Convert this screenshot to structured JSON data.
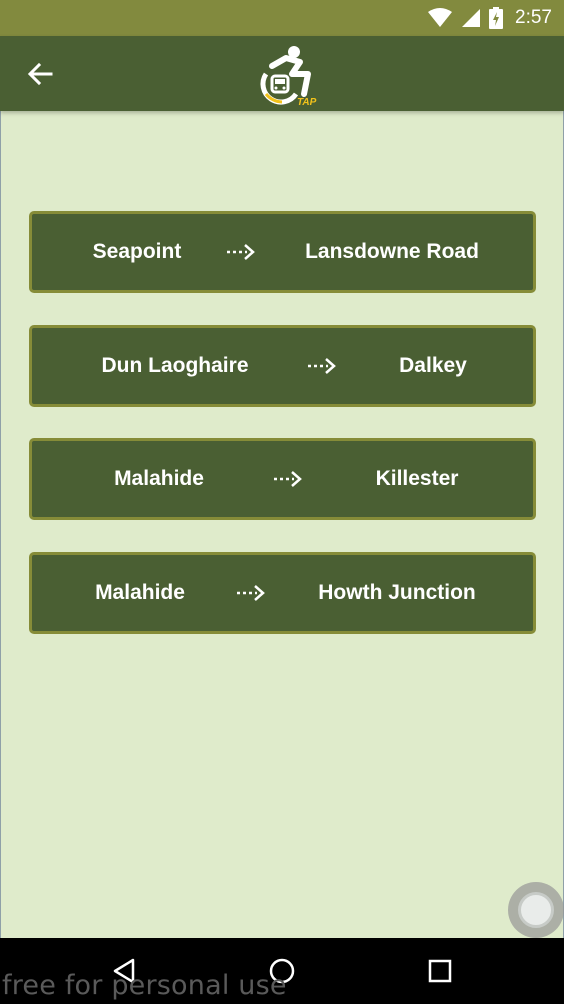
{
  "status_bar": {
    "time": "2:57",
    "icons": [
      "wifi-icon",
      "signal-icon",
      "battery-charging-icon"
    ]
  },
  "app_bar": {
    "back_icon": "arrow-left-icon",
    "logo_text": "TAP",
    "logo_icon": "accessible-train-icon"
  },
  "routes": [
    {
      "from": "Seapoint",
      "to": "Lansdowne Road"
    },
    {
      "from": "Dun Laoghaire",
      "to": "Dalkey"
    },
    {
      "from": "Malahide",
      "to": "Killester"
    },
    {
      "from": "Malahide",
      "to": "Howth Junction"
    }
  ],
  "nav_bar": {
    "back_icon": "nav-back-icon",
    "home_icon": "nav-home-icon",
    "recents_icon": "nav-recents-icon"
  },
  "watermark": "free for personal use",
  "colors": {
    "status_bar": "#828a3e",
    "app_bar": "#4a5f33",
    "background": "#dfebcb",
    "card": "#4a5f33",
    "card_border": "#868c38",
    "logo_accent": "#f2c21b"
  }
}
